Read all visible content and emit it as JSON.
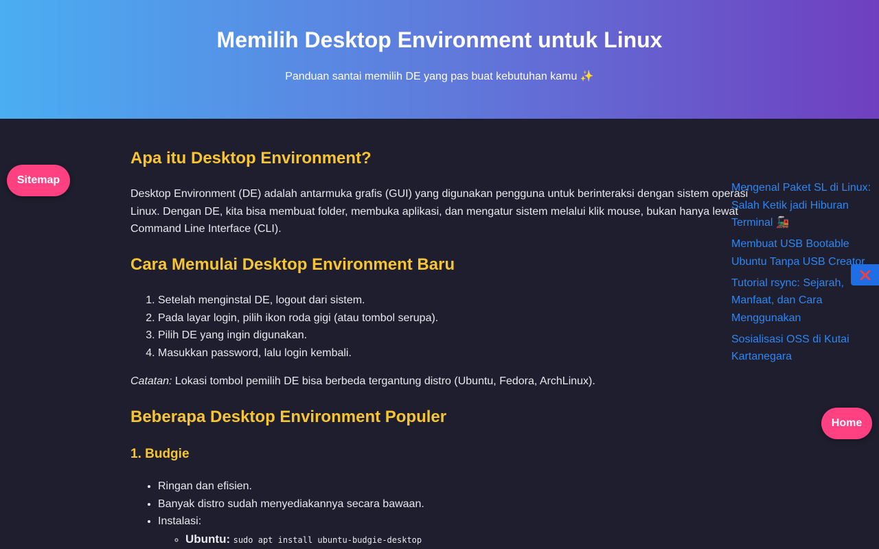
{
  "header": {
    "title": "Memilih Desktop Environment untuk Linux",
    "subtitle": "Panduan santai memilih DE yang pas buat kebutuhan kamu ✨"
  },
  "buttons": {
    "sitemap": "Sitemap",
    "home": "Home",
    "close_icon": "x-icon"
  },
  "article": {
    "h_what": "Apa itu Desktop Environment?",
    "p_what": "Desktop Environment (DE) adalah antarmuka grafis (GUI) yang digunakan pengguna untuk berinteraksi dengan sistem operasi Linux. Dengan DE, kita bisa membuat folder, membuka aplikasi, dan mengatur sistem melalui klik mouse, bukan hanya lewat Command Line Interface (CLI).",
    "h_start": "Cara Memulai Desktop Environment Baru",
    "steps": [
      "Setelah menginstal DE, logout dari sistem.",
      "Pada layar login, pilih ikon roda gigi (atau tombol serupa).",
      "Pilih DE yang ingin digunakan.",
      "Masukkan password, lalu login kembali."
    ],
    "note_label": "Catatan:",
    "note_text": " Lokasi tombol pemilih DE bisa berbeda tergantung distro (Ubuntu, Fedora, ArchLinux).",
    "h_popular": "Beberapa Desktop Environment Populer",
    "h_budgie": "1. Budgie",
    "budgie_points": [
      "Ringan dan efisien.",
      "Banyak distro sudah menyediakannya secara bawaan.",
      "Instalasi:"
    ],
    "budgie_install": {
      "distro": "Ubuntu:",
      "command": "sudo apt install ubuntu-budgie-desktop"
    }
  },
  "sidebar": {
    "links": [
      "Mengenal Paket SL di Linux: Salah Ketik jadi Hiburan Terminal 🚂",
      "Membuat USB Bootable Ubuntu Tanpa USB Creator",
      "Tutorial rsync: Sejarah, Manfaat, dan Cara Menggunakan",
      "Sosialisasi OSS di Kutai Kartanegara"
    ]
  },
  "colors": {
    "accent_heading": "#f7c531",
    "button_pink": "#ff4081",
    "link_blue": "#2f86f0",
    "background": "#1e1e2e"
  }
}
